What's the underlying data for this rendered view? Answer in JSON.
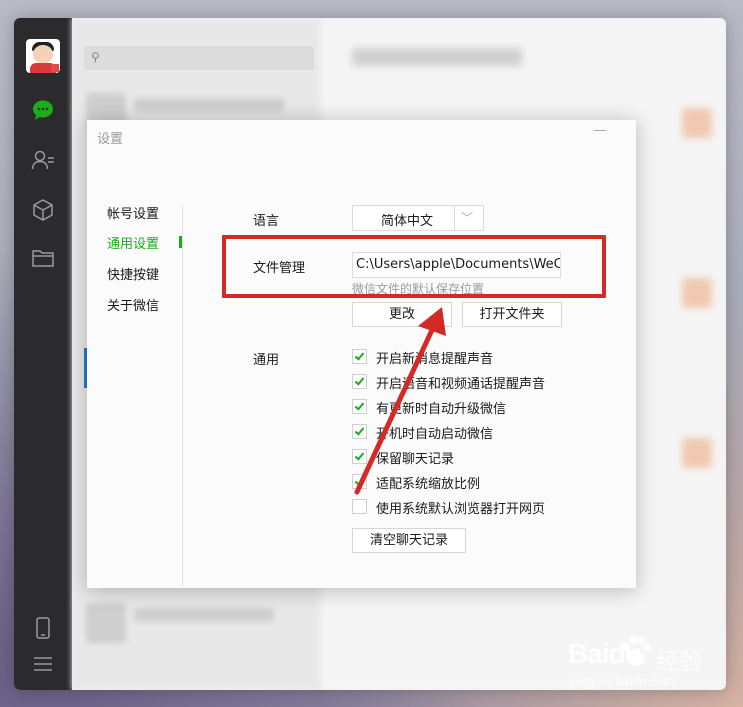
{
  "dialog": {
    "title": "设置"
  },
  "menu": {
    "items": [
      {
        "label": "帐号设置",
        "active": false
      },
      {
        "label": "通用设置",
        "active": true
      },
      {
        "label": "快捷按键",
        "active": false
      },
      {
        "label": "关于微信",
        "active": false
      }
    ]
  },
  "language": {
    "label": "语言",
    "selected": "简体中文"
  },
  "file_management": {
    "label": "文件管理",
    "path": "C:\\Users\\apple\\Documents\\WeChat Files",
    "hint": "微信文件的默认保存位置",
    "change_button": "更改",
    "open_folder_button": "打开文件夹"
  },
  "general": {
    "label": "通用",
    "options": [
      {
        "label": "开启新消息提醒声音",
        "checked": true
      },
      {
        "label": "开启语音和视频通话提醒声音",
        "checked": true
      },
      {
        "label": "有更新时自动升级微信",
        "checked": true
      },
      {
        "label": "开机时自动启动微信",
        "checked": true
      },
      {
        "label": "保留聊天记录",
        "checked": true
      },
      {
        "label": "适配系统缩放比例",
        "checked": true
      },
      {
        "label": "使用系统默认浏览器打开网页",
        "checked": false
      }
    ],
    "clear_history_button": "清空聊天记录"
  },
  "watermark": {
    "brand": "Baidu",
    "brand_cn": "经验",
    "url": "jingyan.baidu.com"
  },
  "colors": {
    "accent_green": "#1aad19",
    "annotation_red": "#d42a27",
    "sidebar_dark": "#2b2b2e"
  },
  "icons": [
    "chat-icon",
    "contacts-icon",
    "favorites-cube-icon",
    "folder-icon",
    "phone-icon",
    "menu-icon",
    "search-icon"
  ]
}
